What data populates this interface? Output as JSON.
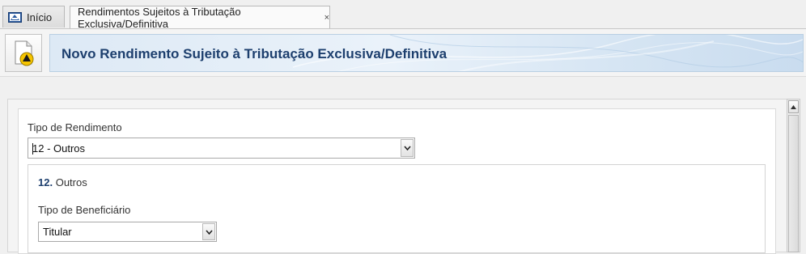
{
  "tabs": {
    "home_label": "Início",
    "active_label": "Rendimentos Sujeitos à Tributação Exclusiva/Definitiva",
    "close_glyph": "×"
  },
  "header": {
    "title": "Novo Rendimento Sujeito à Tributação Exclusiva/Definitiva",
    "icon": "document-warning-icon"
  },
  "form": {
    "tipo_rendimento_label": "Tipo de Rendimento",
    "tipo_rendimento_value": "12 - Outros",
    "section_number": "12.",
    "section_name": "Outros",
    "tipo_beneficiario_label": "Tipo de Beneficiário",
    "tipo_beneficiario_value": "Titular"
  },
  "colors": {
    "accent": "#1d3f6e",
    "banner_light": "#eaf2fa",
    "warning_yellow": "#f5c400"
  }
}
